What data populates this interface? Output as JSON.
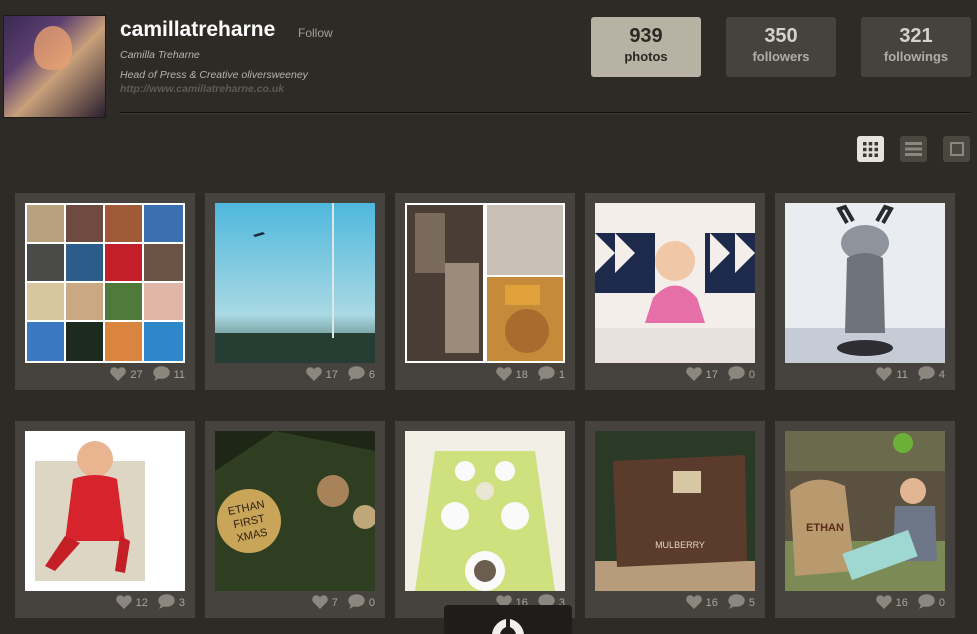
{
  "profile": {
    "username": "camillatreharne",
    "follow_label": "Follow",
    "full_name": "Camilla Treharne",
    "bio": "Head of Press & Creative oliversweeney",
    "website": "http://www.camillatreharne.co.uk"
  },
  "stats": [
    {
      "value": "939",
      "label": "photos"
    },
    {
      "value": "350",
      "label": "followers"
    },
    {
      "value": "321",
      "label": "followings"
    }
  ],
  "view_options": [
    "grid-view-icon",
    "list-view-icon",
    "single-view-icon"
  ],
  "photos": [
    {
      "likes": "27",
      "comments": "11"
    },
    {
      "likes": "17",
      "comments": "6"
    },
    {
      "likes": "18",
      "comments": "1"
    },
    {
      "likes": "17",
      "comments": "0"
    },
    {
      "likes": "11",
      "comments": "4"
    },
    {
      "likes": "12",
      "comments": "3"
    },
    {
      "likes": "7",
      "comments": "0"
    },
    {
      "likes": "16",
      "comments": "3"
    },
    {
      "likes": "16",
      "comments": "5"
    },
    {
      "likes": "16",
      "comments": "0"
    }
  ],
  "photo_captions": {
    "ornament": "ETHAN FIRST XMAS",
    "bag": "MULBERRY",
    "sack": "ETHAN"
  }
}
